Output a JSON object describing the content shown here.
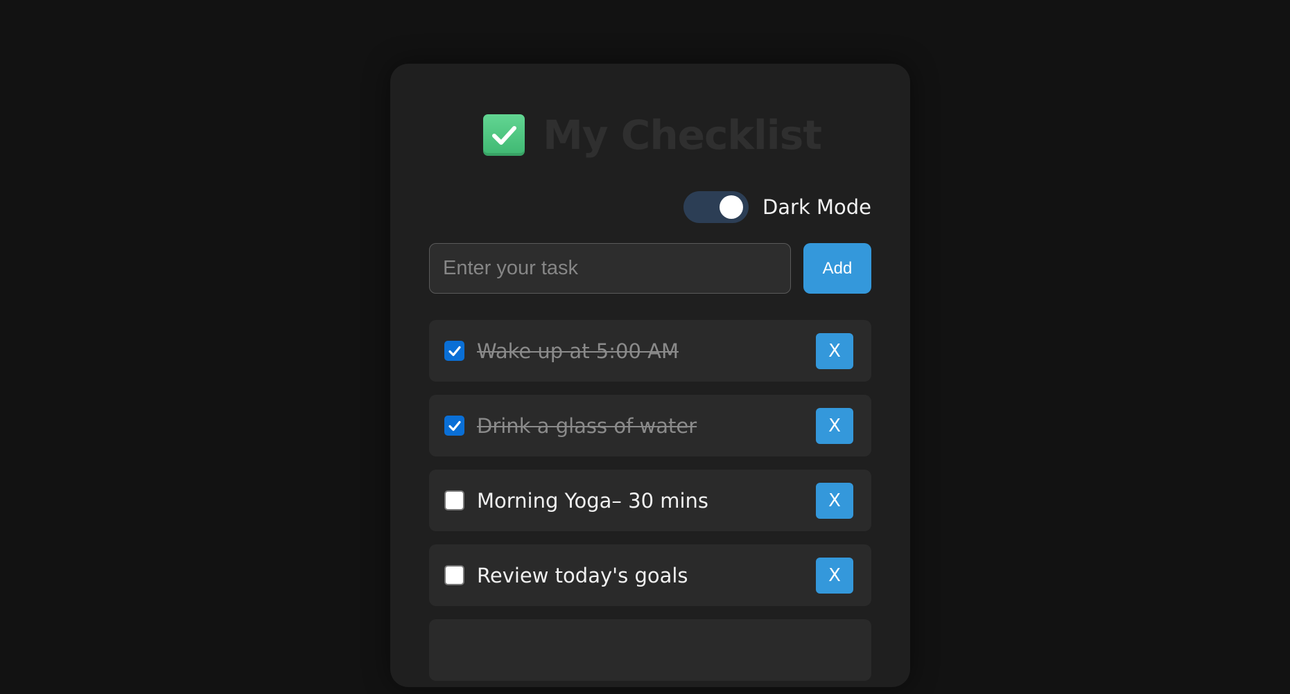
{
  "header": {
    "icon": "check-mark-button-emoji",
    "title": "My Checklist"
  },
  "theme_toggle": {
    "label": "Dark Mode",
    "state": "on",
    "track_color": "#2c3e55"
  },
  "task_form": {
    "placeholder": "Enter your task",
    "value": "",
    "add_label": "Add"
  },
  "tasks": [
    {
      "text": "Wake up at 5:00 AM",
      "done": true,
      "delete_label": "X"
    },
    {
      "text": "Drink a glass of water",
      "done": true,
      "delete_label": "X"
    },
    {
      "text": "Morning Yoga– 30 mins",
      "done": false,
      "delete_label": "X"
    },
    {
      "text": "Review today's goals",
      "done": false,
      "delete_label": "X"
    }
  ],
  "colors": {
    "background": "#121212",
    "card": "#1f1f1f",
    "accent": "#3498db",
    "checkbox_checked": "#0a6fd6",
    "emoji_green": "#4cc981"
  }
}
